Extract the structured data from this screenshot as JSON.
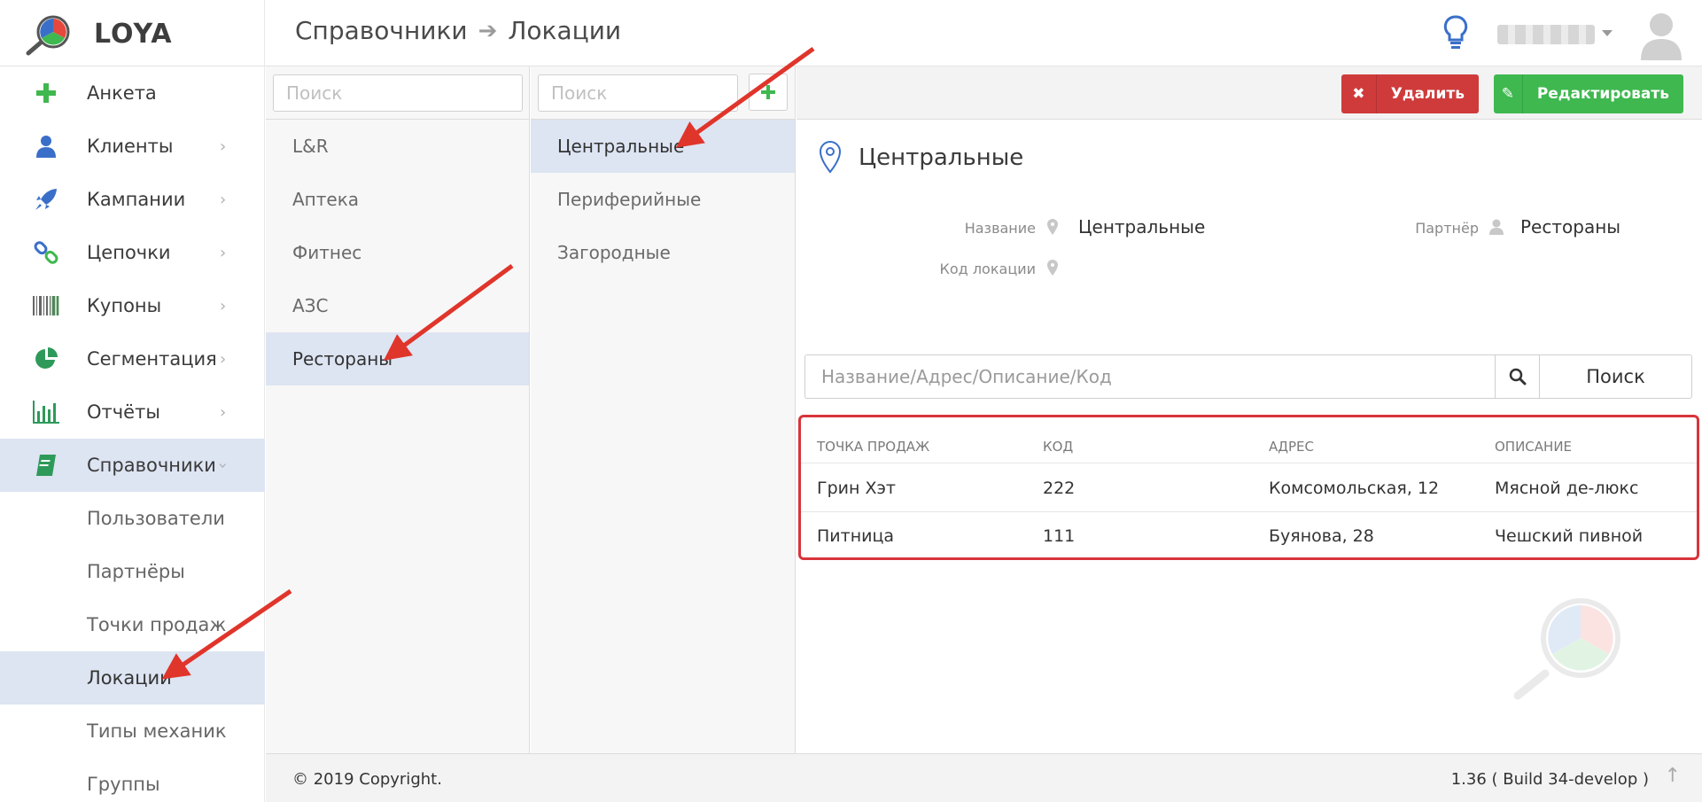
{
  "app": {
    "name": "LOYA"
  },
  "breadcrumb": {
    "parent": "Справочники",
    "current": "Локации"
  },
  "sidebar": {
    "items": [
      {
        "label": "Анкета",
        "icon": "plus-icon"
      },
      {
        "label": "Клиенты",
        "icon": "user-icon"
      },
      {
        "label": "Кампании",
        "icon": "rocket-icon"
      },
      {
        "label": "Цепочки",
        "icon": "chain-icon"
      },
      {
        "label": "Купоны",
        "icon": "barcode-icon"
      },
      {
        "label": "Сегментация",
        "icon": "pie-chart-icon"
      },
      {
        "label": "Отчёты",
        "icon": "bar-chart-icon"
      },
      {
        "label": "Справочники",
        "icon": "book-icon"
      }
    ],
    "subitems": [
      {
        "label": "Пользователи"
      },
      {
        "label": "Партнёры"
      },
      {
        "label": "Точки продаж"
      },
      {
        "label": "Локации"
      },
      {
        "label": "Типы механик"
      },
      {
        "label": "Группы"
      }
    ]
  },
  "partners": {
    "search_placeholder": "Поиск",
    "items": [
      "L&R",
      "Аптека",
      "Фитнес",
      "АЗС",
      "Рестораны"
    ],
    "selected": "Рестораны"
  },
  "locations": {
    "search_placeholder": "Поиск",
    "items": [
      "Центральные",
      "Периферийные",
      "Загородные"
    ],
    "selected": "Центральные"
  },
  "toolbar": {
    "delete_label": "Удалить",
    "edit_label": "Редактировать"
  },
  "detail": {
    "title": "Центральные",
    "name_label": "Название",
    "name_value": "Центральные",
    "partner_label": "Партнёр",
    "partner_value": "Рестораны",
    "code_label": "Код локации",
    "code_value": ""
  },
  "search": {
    "placeholder": "Название/Адрес/Описание/Код",
    "button_label": "Поиск"
  },
  "table": {
    "headers": [
      "ТОЧКА ПРОДАЖ",
      "КОД",
      "АДРЕС",
      "ОПИСАНИЕ"
    ],
    "rows": [
      [
        "Грин Хэт",
        "222",
        "Комсомольская, 12",
        "Мясной де-люкс"
      ],
      [
        "Питница",
        "111",
        "Буянова, 28",
        "Чешский пивной"
      ]
    ]
  },
  "footer": {
    "copyright": "© 2019 Copyright.",
    "version": "1.36 ( Build 34-develop )"
  },
  "colors": {
    "delete": "#cf3b3b",
    "edit": "#3fb84f",
    "selected_bg": "#dde4f2",
    "highlight_frame": "#d8343a",
    "arrow": "#e0352b"
  }
}
